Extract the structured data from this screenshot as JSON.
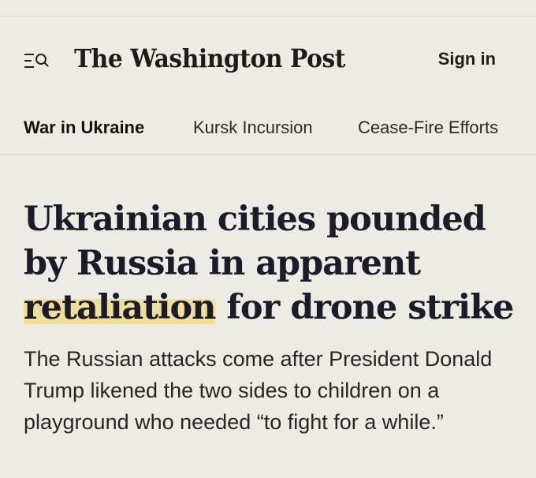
{
  "header": {
    "logo_text": "The Washington Post",
    "sign_in_label": "Sign in",
    "menu_icon": "menu-search-icon"
  },
  "nav": {
    "items": [
      {
        "label": "War in Ukraine",
        "active": true
      },
      {
        "label": "Kursk Incursion",
        "active": false
      },
      {
        "label": "Cease-Fire Efforts",
        "active": false
      }
    ]
  },
  "article": {
    "headline_part1": "Ukrainian cities pounded by Russia in apparent ",
    "headline_highlight": "retaliation",
    "headline_part2": " for drone strike",
    "highlight_color": "#f0df9a",
    "dek": "The Russian attacks come after President Donald Trump likened the two sides to children on a playground who needed “to fight for a while.”"
  },
  "colors": {
    "background": "#ecebe4",
    "text": "#1f1f1f"
  }
}
